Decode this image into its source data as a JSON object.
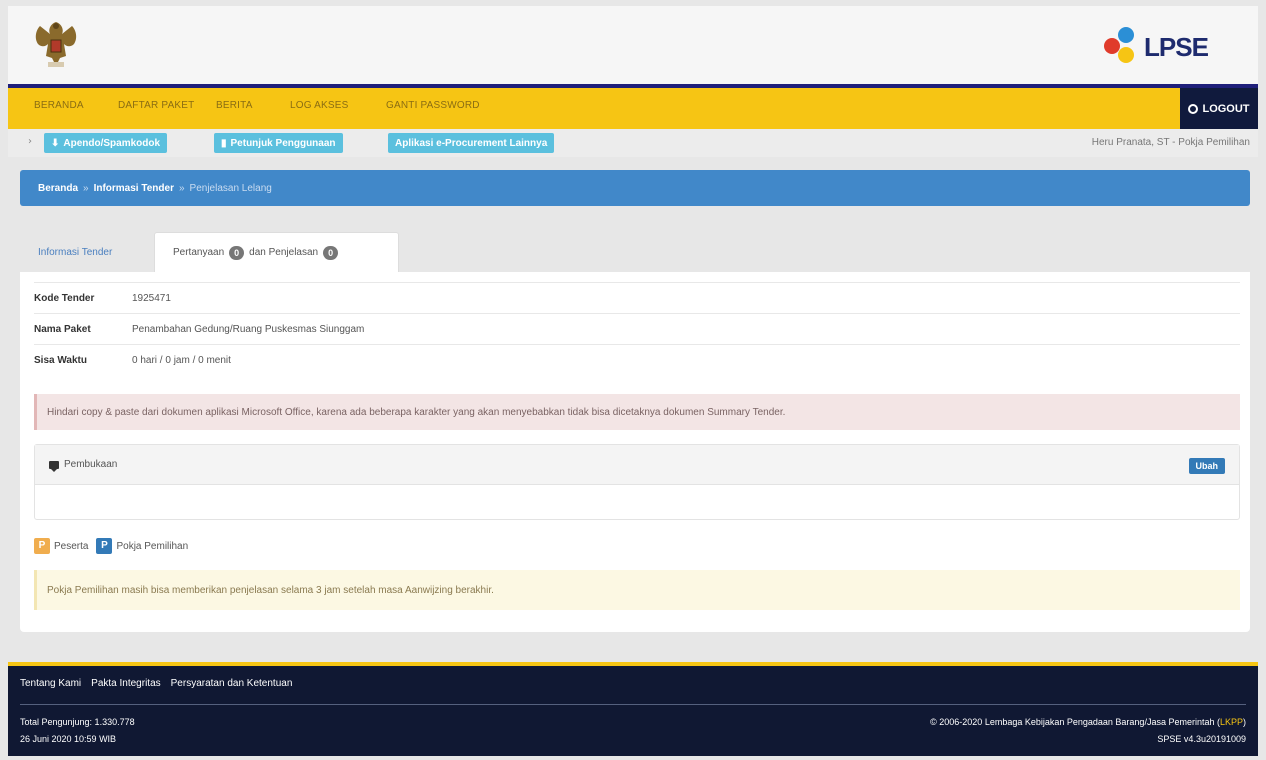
{
  "header": {
    "lpse_logo_text": "LPSE",
    "emblem_icon": "garuda-emblem-icon"
  },
  "nav": {
    "items": [
      "BERANDA",
      "DAFTAR PAKET",
      "BERITA",
      "LOG AKSES",
      "GANTI PASSWORD"
    ],
    "logout_label": "LOGOUT"
  },
  "toolbar": {
    "btn1": "Apendo/Spamkodok",
    "btn2": "Petunjuk Penggunaan",
    "btn3": "Aplikasi e-Procurement Lainnya",
    "user": "Heru Pranata, ST - Pokja Pemilihan"
  },
  "breadcrumb": {
    "home": "Beranda",
    "info": "Informasi Tender",
    "current": "Penjelasan Lelang"
  },
  "tabs": {
    "info_label": "Informasi Tender",
    "pertanyaan_label": "Pertanyaan",
    "pertanyaan_count": "0",
    "dan_label": "dan Penjelasan",
    "penjelasan_count": "0"
  },
  "tender": {
    "kode_label": "Kode Tender",
    "kode_value": "1925471",
    "nama_label": "Nama Paket",
    "nama_value": "Penambahan Gedung/Ruang Puskesmas Siunggam",
    "sisa_label": "Sisa Waktu",
    "sisa_value": "0 hari / 0 jam / 0 menit"
  },
  "alert_danger": "Hindari copy & paste dari dokumen aplikasi Microsoft Office, karena ada beberapa karakter yang akan menyebabkan tidak bisa dicetaknya dokumen Summary Tender.",
  "pembukaan": {
    "label": "Pembukaan",
    "ubah_label": "Ubah"
  },
  "legend": {
    "p_badge": "P",
    "peserta": "Peserta",
    "pk_badge": "P",
    "pokja": "Pokja Pemilihan"
  },
  "alert_warning": "Pokja Pemilihan masih bisa memberikan penjelasan selama 3 jam setelah masa Aanwijzing berakhir.",
  "footer": {
    "links": [
      "Tentang Kami",
      "Pakta Integritas",
      "Persyaratan dan Ketentuan"
    ],
    "visitors": "Total Pengunjung: 1.330.778",
    "datetime": "26 Juni 2020 10:59 WIB",
    "copyright": "© 2006-2020 Lembaga Kebijakan Pengadaan Barang/Jasa Pemerintah (",
    "lkpp": "LKPP",
    "copyright_end": ")",
    "version": "SPSE v4.3u20191009"
  },
  "colors": {
    "nav": "#f6c514",
    "breadcrumb": "#4188c9",
    "footer": "#101833",
    "accent": "#5bc0de"
  }
}
